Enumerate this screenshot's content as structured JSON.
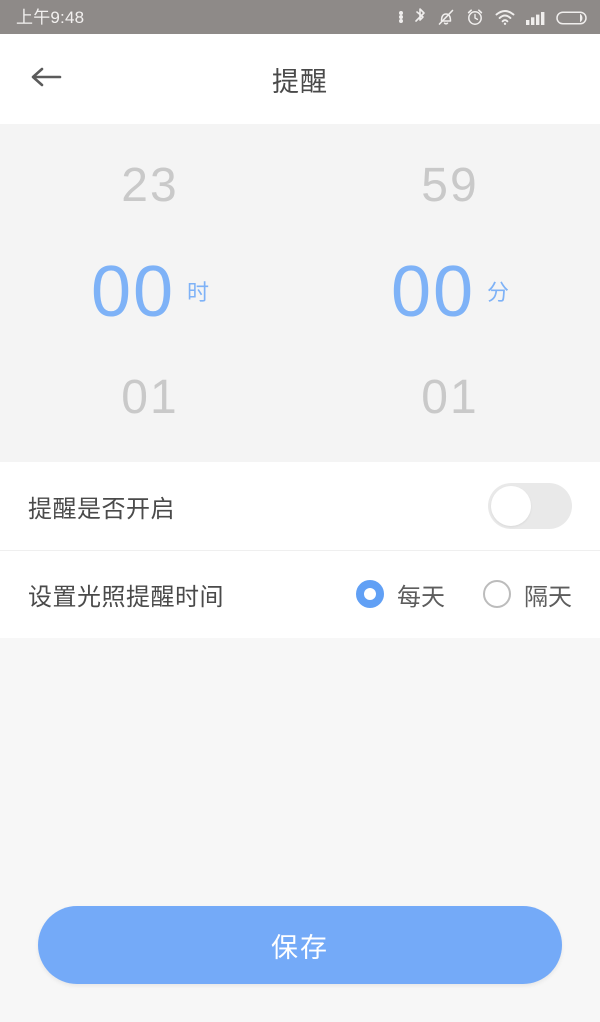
{
  "status_bar": {
    "time": "上午9:48",
    "icons": [
      "more-dots-icon",
      "bluetooth-icon",
      "silent-mode-icon",
      "alarm-icon",
      "wifi-icon",
      "signal-icon",
      "battery-icon"
    ],
    "background_color": "#8e8a88"
  },
  "header": {
    "back_icon": "back-arrow-icon",
    "title": "提醒"
  },
  "time_picker": {
    "accent_color": "#7eb2f7",
    "hour": {
      "prev": "23",
      "selected": "00",
      "next": "01",
      "unit": "时"
    },
    "minute": {
      "prev": "59",
      "selected": "00",
      "next": "01",
      "unit": "分"
    }
  },
  "settings": {
    "toggle_row": {
      "label": "提醒是否开启",
      "enabled": false
    },
    "radio_row": {
      "label": "设置光照提醒时间",
      "options": [
        {
          "label": "每天",
          "selected": true
        },
        {
          "label": "隔天",
          "selected": false
        }
      ]
    }
  },
  "footer": {
    "save_label": "保存",
    "save_color": "#74aaf8"
  }
}
